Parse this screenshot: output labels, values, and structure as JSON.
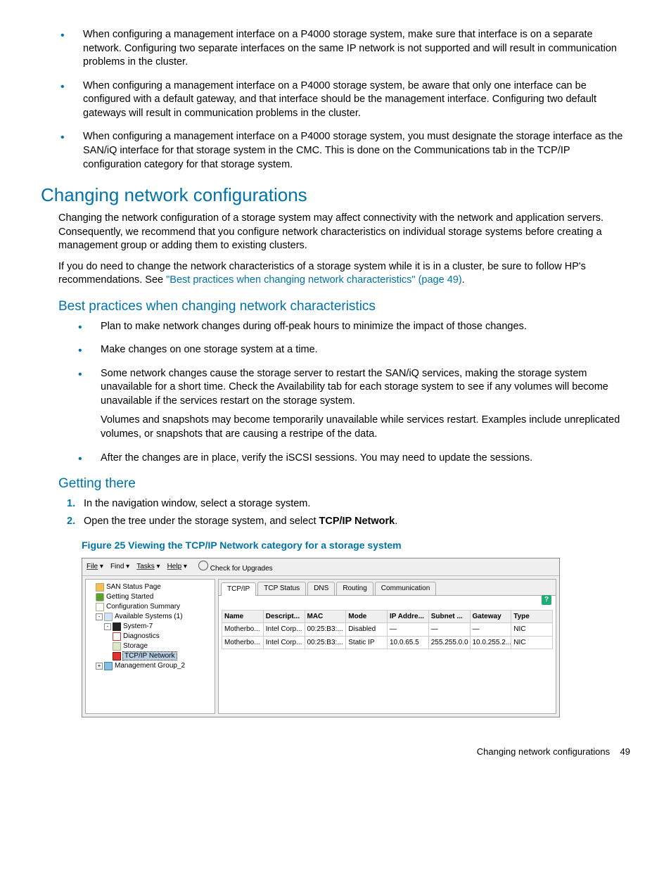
{
  "bullets_top": [
    "When configuring a management interface on a P4000 storage system, make sure that interface is on a separate network. Configuring two separate interfaces on the same IP network is not supported and will result in communication problems in the cluster.",
    "When configuring a management interface on a P4000 storage system, be aware that only one interface can be configured with a default gateway, and that interface should be the management interface. Configuring two default gateways will result in communication problems in the cluster.",
    "When configuring a management interface on a P4000 storage system, you must designate the storage interface as the SAN/iQ interface for that storage system in the CMC. This is done on the Communications tab in the TCP/IP configuration category for that storage system."
  ],
  "headings": {
    "h1a": "Changing network configurations",
    "h2a": "Best practices when changing network characteristics",
    "h2b": "Getting there"
  },
  "p1": "Changing the network configuration of a storage system may affect connectivity with the network and application servers. Consequently, we recommend that you configure network characteristics on individual storage systems before creating a management group or adding them to existing clusters.",
  "p2a": "If you do need to change the network characteristics of a storage system while it is in a cluster, be sure to follow HP's recommendations. See ",
  "p2link": "\"Best practices when changing network characteristics\" (page 49)",
  "p2b": ".",
  "best_practices": [
    "Plan to make network changes during off-peak hours to minimize the impact of those changes.",
    "Make changes on one storage system at a time.",
    "Some network changes cause the storage server to restart the SAN/iQ services, making the storage system unavailable for a short time. Check the Availability tab for each storage system to see if any volumes will become unavailable if the services restart on the storage system.",
    "After the changes are in place, verify the iSCSI sessions. You may need to update the sessions."
  ],
  "best_practices_note": "Volumes and snapshots may become temporarily unavailable while services restart. Examples include unreplicated volumes, or snapshots that are causing a restripe of the data.",
  "steps": {
    "s1": "In the navigation window, select a storage system.",
    "s2a": "Open the tree under the storage system, and select ",
    "s2b": "TCP/IP Network",
    "s2c": "."
  },
  "figure_caption": "Figure 25 Viewing the TCP/IP Network category for a storage system",
  "footer": {
    "title": "Changing network configurations",
    "page": "49"
  },
  "window": {
    "menus": {
      "file": "File",
      "find": "Find",
      "tasks": "Tasks",
      "help": "Help",
      "upgrades": "Check for Upgrades"
    },
    "tree": {
      "san": "SAN Status Page",
      "gs": "Getting Started",
      "cs": "Configuration Summary",
      "avail": "Available Systems (1)",
      "sys": "System-7",
      "diag": "Diagnostics",
      "stor": "Storage",
      "tcp": "TCP/IP Network",
      "mg": "Management Group_2"
    },
    "tabs": {
      "t1": "TCP/IP",
      "t2": "TCP Status",
      "t3": "DNS",
      "t4": "Routing",
      "t5": "Communication"
    },
    "help": "?",
    "table": {
      "headers": {
        "c1": "Name",
        "c2": "Descript...",
        "c3": "MAC",
        "c4": "Mode",
        "c5": "IP Addre...",
        "c6": "Subnet ...",
        "c7": "Gateway",
        "c8": "Type"
      },
      "r1": {
        "c1": "Motherbo...",
        "c2": "Intel Corp...",
        "c3": "00:25:B3:...",
        "c4": "Disabled",
        "c5": "—",
        "c6": "—",
        "c7": "—",
        "c8": "NIC"
      },
      "r2": {
        "c1": "Motherbo...",
        "c2": "Intel Corp...",
        "c3": "00:25:B3:...",
        "c4": "Static IP",
        "c5": "10.0.65.5",
        "c6": "255.255.0.0",
        "c7": "10.0.255.2...",
        "c8": "NIC"
      }
    }
  }
}
